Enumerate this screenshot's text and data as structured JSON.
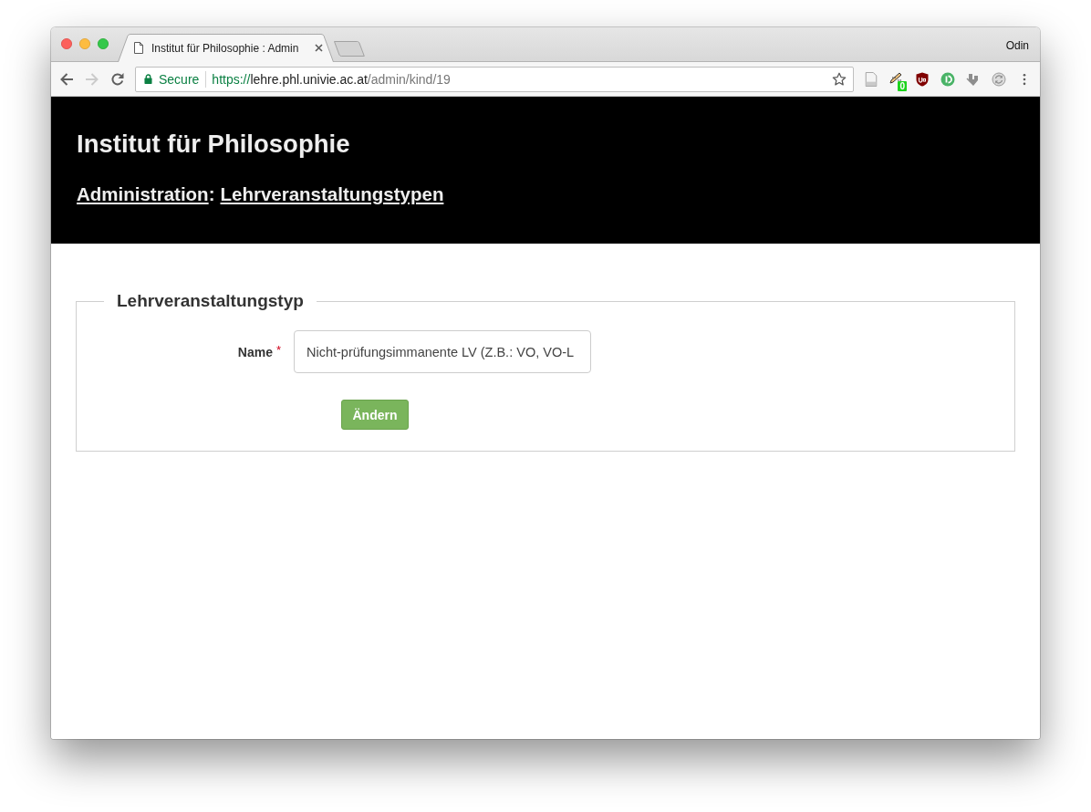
{
  "tabs": [
    {
      "title": "Institut für Philosophie : Admin",
      "selected": true
    }
  ],
  "profile": {
    "name": "Odin"
  },
  "navigation": [
    {
      "kind": "back",
      "disabled": false
    },
    {
      "kind": "forward",
      "disabled": true
    },
    {
      "kind": "reload",
      "disabled": false
    }
  ],
  "address_bar": {
    "security_label": "Secure",
    "url": {
      "scheme": "https://",
      "host": "lehre.phl.univie.ac.at",
      "path": "/admin/kind/19"
    },
    "bookmarked": false
  },
  "extensions": [
    {
      "kind": "document"
    },
    {
      "kind": "pen",
      "badge": "0"
    },
    {
      "kind": "shield"
    },
    {
      "kind": "disc"
    },
    {
      "kind": "arrow"
    },
    {
      "kind": "sync"
    }
  ],
  "header": {
    "title": "Institut für Philosophie",
    "breadcrumb": {
      "links": [
        "Administration",
        "Lehrveranstaltungstypen"
      ],
      "separator": ":"
    }
  },
  "form": {
    "legend": "Lehrveranstaltungstyp",
    "fields": [
      {
        "label": "Name",
        "required_mark": "*",
        "value": "Nicht-prüfungsimmanente LV (Z.B.: VO, VO-L"
      }
    ],
    "submit": "Ändern"
  }
}
